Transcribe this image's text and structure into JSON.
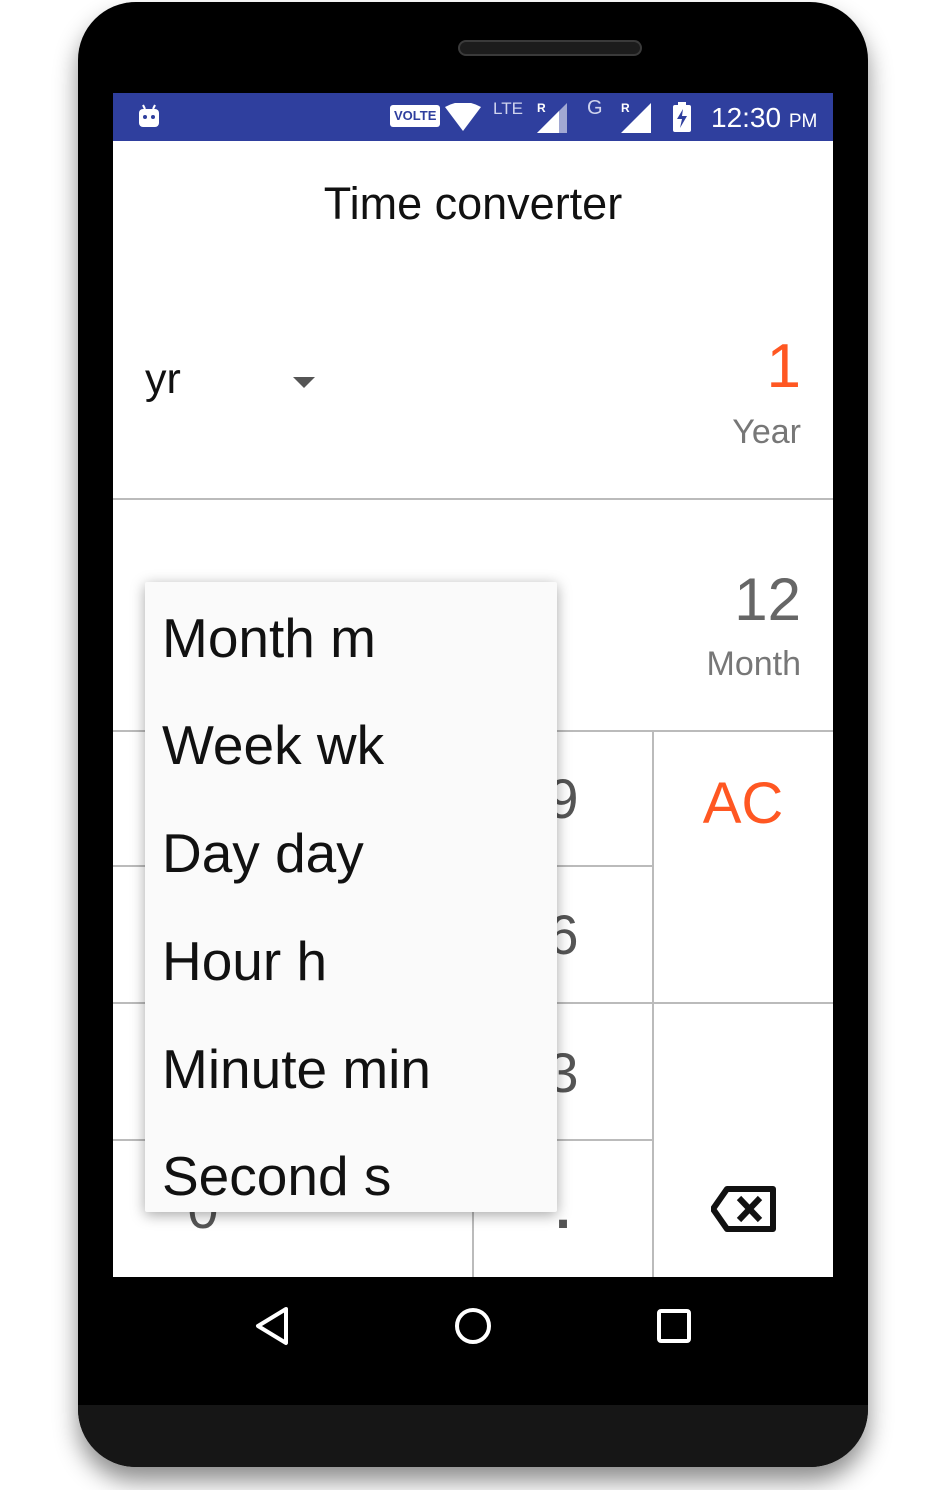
{
  "status_bar": {
    "volte": "VOLTE",
    "network_1": "LTE",
    "roaming_1": "R",
    "network_2": "G",
    "roaming_2": "R",
    "time": "12:30",
    "ampm": "PM",
    "icons": [
      "android-icon",
      "wifi-icon",
      "signal-icon",
      "battery-charging-icon"
    ]
  },
  "app": {
    "title": "Time converter"
  },
  "converter": {
    "from_unit_select": "yr",
    "from_value": "1",
    "from_unit_name": "Year",
    "to_value": "12",
    "to_unit_name": "Month"
  },
  "keypad": {
    "visible_keys": [
      "9",
      "6",
      "3",
      "0",
      "."
    ],
    "clear_label": "AC",
    "backspace_icon": "backspace-icon"
  },
  "dropdown": {
    "items": [
      "Month m",
      "Week wk",
      "Day day",
      "Hour h",
      "Minute min",
      "Second s"
    ]
  },
  "nav_bar": {
    "icons": [
      "back-icon",
      "home-icon",
      "recents-icon"
    ]
  },
  "colors": {
    "status_bar": "#2f3f9e",
    "accent": "#ff5722",
    "text_primary": "#111111",
    "text_secondary": "#777777"
  }
}
